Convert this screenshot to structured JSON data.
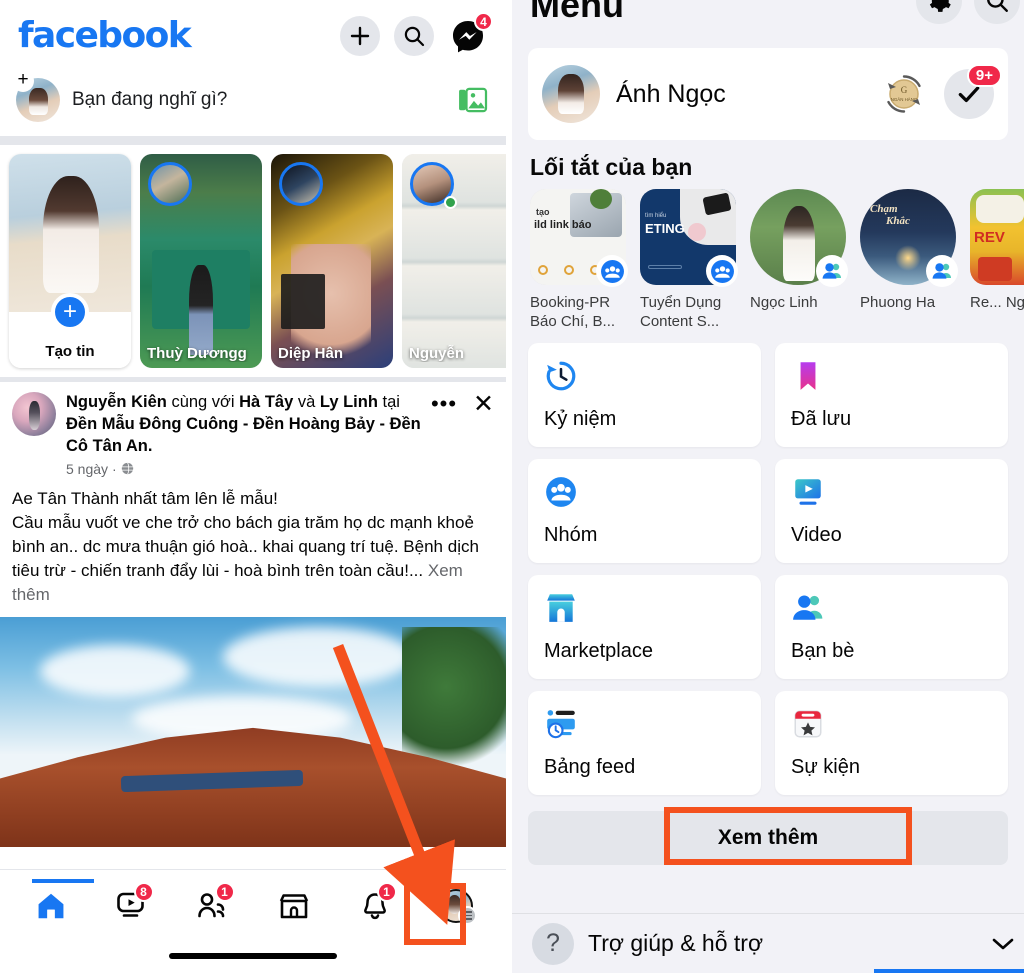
{
  "feed": {
    "app_name": "facebook",
    "header": {
      "add_icon": "plus-icon",
      "search_icon": "search-icon",
      "messenger_icon": "messenger-icon",
      "messenger_badge": "4"
    },
    "composer": {
      "placeholder": "Bạn đang nghĩ gì?",
      "photo_icon": "photo-library-icon",
      "avatar_plus": "+"
    },
    "stories": [
      {
        "name": "Tạo tin",
        "type": "create",
        "plus": "+"
      },
      {
        "name": "Thuỳ Dươngg",
        "type": "story"
      },
      {
        "name": "Diệp Hân",
        "type": "story"
      },
      {
        "name": "Nguyễn",
        "type": "story",
        "online": true
      }
    ],
    "post": {
      "author": "Nguyễn Kiên",
      "with_text": " cùng với ",
      "tagged_1": "Hà Tây",
      "and_text": " và ",
      "tagged_2": "Ly Linh",
      "at_text": " tại ",
      "place": "Đền Mẫu Đông Cuông - Đền Hoàng Bảy - Đền Cô Tân An.",
      "time": "5 ngày",
      "separator": "·",
      "audience_icon": "globe-icon",
      "menu_icon": "ellipsis-icon",
      "close_icon": "close-icon",
      "body": "Ae Tân Thành nhất tâm lên lễ mẫu!\nCầu mẫu vuốt ve che trở cho bách gia trăm họ dc mạnh khoẻ bình an.. dc mưa thuận gió hoà.. khai quang trí tuệ. Bệnh dịch tiêu trừ - chiến tranh đẩy lùi - hoà bình trên toàn cầu!...",
      "see_more": "Xem thêm"
    },
    "bottom_nav": [
      {
        "name": "home",
        "icon": "home-icon",
        "badge": "",
        "active": true
      },
      {
        "name": "video",
        "icon": "video-icon",
        "badge": "8",
        "active": false
      },
      {
        "name": "friends",
        "icon": "friends-icon",
        "badge": "1",
        "active": false
      },
      {
        "name": "marketplace",
        "icon": "marketplace-icon",
        "badge": "",
        "active": false
      },
      {
        "name": "notifications",
        "icon": "bell-icon",
        "badge": "1",
        "active": false
      },
      {
        "name": "menu",
        "icon": "profile-menu-avatar-icon",
        "badge": "",
        "active": false
      }
    ]
  },
  "menu": {
    "title": "Menu",
    "top_icons": [
      {
        "name": "settings-gear-icon"
      },
      {
        "name": "search-icon"
      }
    ],
    "profile": {
      "name": "Ánh Ngọc",
      "coin_icon": "coin-rotate-icon",
      "check_icon": "check-icon",
      "check_badge": "9+"
    },
    "shortcuts_title": "Lối tắt của bạn",
    "shortcuts": [
      {
        "label": "Booking-PR Báo Chí, B...",
        "shape": "rounded",
        "badge": "group-icon"
      },
      {
        "label": "Tuyển Dụng Content S...",
        "shape": "rounded",
        "badge": "group-icon"
      },
      {
        "label": "Ngọc Linh",
        "shape": "round",
        "badge": "friends-icon"
      },
      {
        "label": "Phuong Ha",
        "shape": "round",
        "badge": "friends-icon"
      },
      {
        "label": "Re... Ng...",
        "shape": "rounded",
        "badge": ""
      }
    ],
    "tiles": [
      {
        "label": "Kỷ niệm",
        "icon": "memories-clock-icon"
      },
      {
        "label": "Đã lưu",
        "icon": "saved-bookmark-icon"
      },
      {
        "label": "Nhóm",
        "icon": "groups-icon"
      },
      {
        "label": "Video",
        "icon": "video-icon"
      },
      {
        "label": "Marketplace",
        "icon": "marketplace-icon"
      },
      {
        "label": "Bạn bè",
        "icon": "friends-icon"
      },
      {
        "label": "Bảng feed",
        "icon": "feeds-icon"
      },
      {
        "label": "Sự kiện",
        "icon": "events-calendar-icon"
      }
    ],
    "see_more": "Xem thêm",
    "help": {
      "label": "Trợ giúp & hỗ trợ",
      "icon": "question-mark-icon",
      "chevron": "chevron-down-icon"
    }
  },
  "annotations": {
    "highlight_color": "#F4511E",
    "arrow_label": "arrow-pointing-to-menu-tab"
  }
}
